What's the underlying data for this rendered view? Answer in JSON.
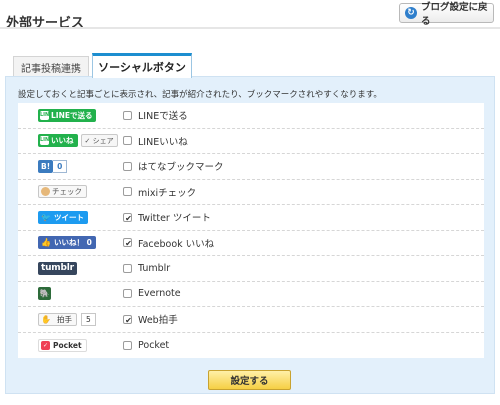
{
  "page": {
    "title": "外部サービス",
    "back_button_label": "ブログ設定に戻る"
  },
  "tabs": [
    {
      "label": "記事投稿連携",
      "active": false
    },
    {
      "label": "ソーシャルボタン",
      "active": true
    }
  ],
  "panel": {
    "description": "設定しておくと記事ごとに表示され、記事が紹介されたり、ブックマークされやすくなります。",
    "submit_label": "設定する"
  },
  "services": [
    {
      "label": "LINEで送る",
      "checked": false,
      "button_text": "LINEで送る",
      "icon": "line-icon"
    },
    {
      "label": "LINEいいね",
      "checked": false,
      "button_text": "いいね",
      "share_text": "✓ シェア",
      "icon": "line-like-icon"
    },
    {
      "label": "はてなブックマーク",
      "checked": false,
      "button_text": "B!",
      "count": "0",
      "icon": "hatena-icon"
    },
    {
      "label": "mixiチェック",
      "checked": false,
      "button_text": "チェック",
      "icon": "mixi-icon"
    },
    {
      "label": "Twitter ツイート",
      "checked": true,
      "button_text": "ツイート",
      "icon": "twitter-bird-icon"
    },
    {
      "label": "Facebook いいね",
      "checked": true,
      "button_text": "いいね！ 0",
      "icon": "facebook-thumb-icon"
    },
    {
      "label": "Tumblr",
      "checked": false,
      "button_text": "tumblr",
      "icon": "tumblr-icon"
    },
    {
      "label": "Evernote",
      "checked": false,
      "button_text": "",
      "icon": "evernote-icon"
    },
    {
      "label": "Web拍手",
      "checked": true,
      "button_text": "拍手",
      "count": "5",
      "icon": "webclap-icon"
    },
    {
      "label": "Pocket",
      "checked": false,
      "button_text": "Pocket",
      "icon": "pocket-icon"
    }
  ],
  "colors": {
    "accent": "#1c8ed0",
    "panel_bg": "#e3f0fb",
    "submit_bg": "#f6cf44",
    "line_green": "#22b14c",
    "hatena_blue": "#3b7bbf",
    "twitter_blue": "#1d9bf0",
    "facebook_blue": "#4267b2",
    "tumblr_navy": "#36465d",
    "evernote_green": "#2d6b3a",
    "pocket_red": "#ef4056"
  }
}
